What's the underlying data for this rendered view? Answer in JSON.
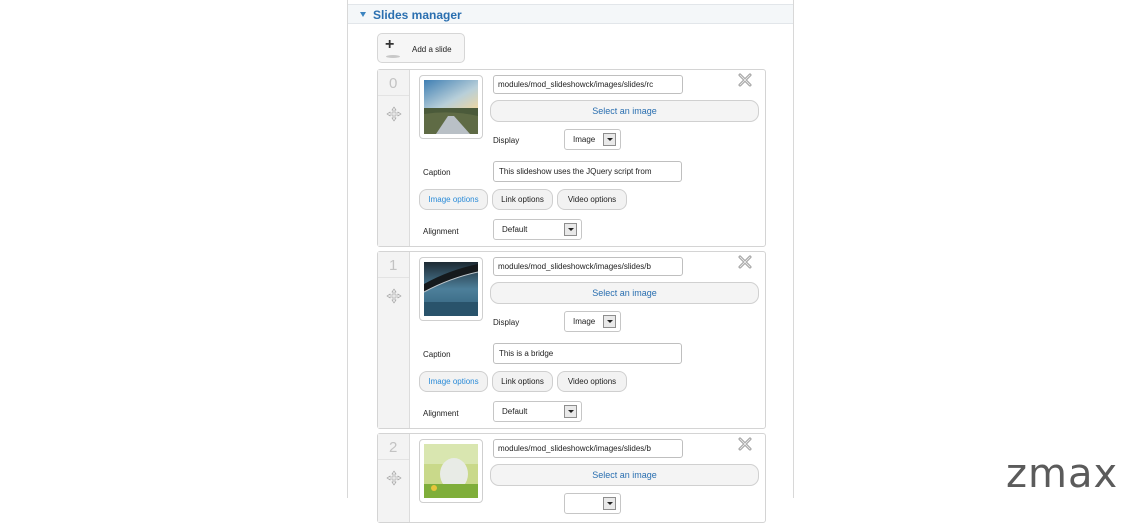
{
  "panel": {
    "title": "Slides manager"
  },
  "add_slide": {
    "label": "Add a slide"
  },
  "slides": [
    {
      "index": "0",
      "image_path": "modules/mod_slideshowck/images/slides/rc",
      "select_label": "Select an image",
      "display_label": "Display",
      "display_value": "Image",
      "caption_label": "Caption",
      "caption_value": "This slideshow uses the JQuery script from",
      "tabs": [
        "Image options",
        "Link options",
        "Video options"
      ],
      "alignment_label": "Alignment",
      "alignment_value": "Default"
    },
    {
      "index": "1",
      "image_path": "modules/mod_slideshowck/images/slides/b",
      "select_label": "Select an image",
      "display_label": "Display",
      "display_value": "Image",
      "caption_label": "Caption",
      "caption_value": "This is a bridge",
      "tabs": [
        "Image options",
        "Link options",
        "Video options"
      ],
      "alignment_label": "Alignment",
      "alignment_value": "Default"
    },
    {
      "index": "2",
      "image_path": "modules/mod_slideshowck/images/slides/b",
      "select_label": "Select an image"
    }
  ],
  "watermark": "zmax",
  "colors": {
    "accent": "#2a6fb0",
    "active_tab": "#2a8bd8"
  }
}
